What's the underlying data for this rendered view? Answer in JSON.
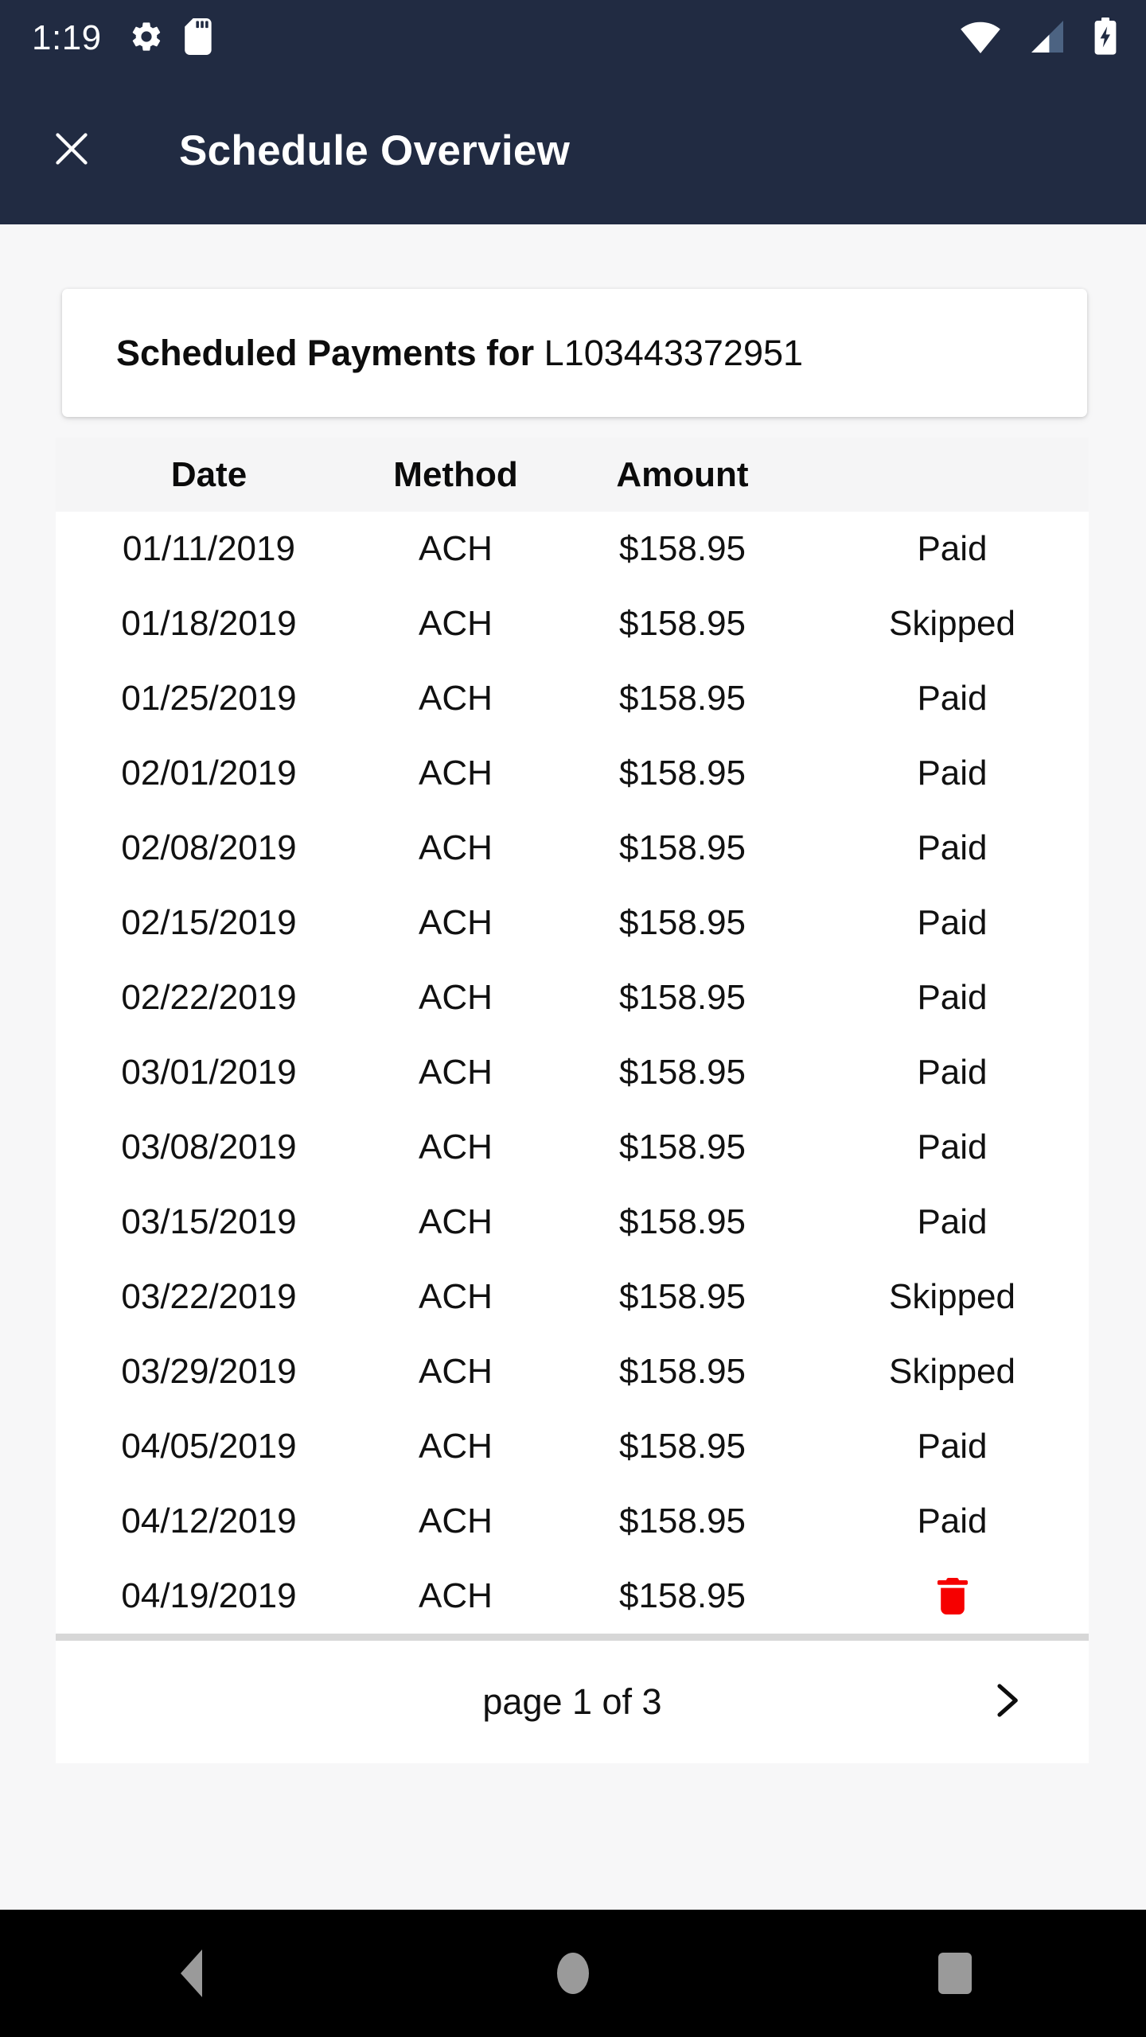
{
  "status_bar": {
    "time": "1:19",
    "left_icons": [
      "settings-gear-icon",
      "sd-card-icon"
    ],
    "right_icons": [
      "wifi-icon",
      "cellular-signal-icon",
      "battery-charging-icon"
    ],
    "background_color": "#212b42"
  },
  "app_bar": {
    "close_icon": "close-icon",
    "title": "Schedule Overview",
    "background_color": "#212b42",
    "text_color": "#ffffff"
  },
  "card": {
    "title_prefix": "Scheduled Payments for",
    "loan_id": "L103443372951"
  },
  "table": {
    "columns": [
      "Date",
      "Method",
      "Amount",
      ""
    ],
    "rows": [
      {
        "date": "01/11/2019",
        "method": "ACH",
        "amount": "$158.95",
        "status": "Paid",
        "action": ""
      },
      {
        "date": "01/18/2019",
        "method": "ACH",
        "amount": "$158.95",
        "status": "Skipped",
        "action": ""
      },
      {
        "date": "01/25/2019",
        "method": "ACH",
        "amount": "$158.95",
        "status": "Paid",
        "action": ""
      },
      {
        "date": "02/01/2019",
        "method": "ACH",
        "amount": "$158.95",
        "status": "Paid",
        "action": ""
      },
      {
        "date": "02/08/2019",
        "method": "ACH",
        "amount": "$158.95",
        "status": "Paid",
        "action": ""
      },
      {
        "date": "02/15/2019",
        "method": "ACH",
        "amount": "$158.95",
        "status": "Paid",
        "action": ""
      },
      {
        "date": "02/22/2019",
        "method": "ACH",
        "amount": "$158.95",
        "status": "Paid",
        "action": ""
      },
      {
        "date": "03/01/2019",
        "method": "ACH",
        "amount": "$158.95",
        "status": "Paid",
        "action": ""
      },
      {
        "date": "03/08/2019",
        "method": "ACH",
        "amount": "$158.95",
        "status": "Paid",
        "action": ""
      },
      {
        "date": "03/15/2019",
        "method": "ACH",
        "amount": "$158.95",
        "status": "Paid",
        "action": ""
      },
      {
        "date": "03/22/2019",
        "method": "ACH",
        "amount": "$158.95",
        "status": "Skipped",
        "action": ""
      },
      {
        "date": "03/29/2019",
        "method": "ACH",
        "amount": "$158.95",
        "status": "Skipped",
        "action": ""
      },
      {
        "date": "04/05/2019",
        "method": "ACH",
        "amount": "$158.95",
        "status": "Paid",
        "action": ""
      },
      {
        "date": "04/12/2019",
        "method": "ACH",
        "amount": "$158.95",
        "status": "Paid",
        "action": ""
      },
      {
        "date": "04/19/2019",
        "method": "ACH",
        "amount": "$158.95",
        "status": "",
        "action": "delete-icon"
      }
    ]
  },
  "pagination": {
    "label": "page 1 of 3",
    "current_page": 1,
    "total_pages": 3,
    "next_icon": "chevron-right-icon"
  },
  "nav_bar": {
    "buttons": [
      "back-icon",
      "home-icon",
      "recent-apps-icon"
    ],
    "background_color": "#000000",
    "icon_color": "#9a9a9a"
  },
  "colors": {
    "header": "#212b42",
    "page_background": "#f7f7f8",
    "card_background": "#ffffff",
    "table_header_background": "#f5f5f6",
    "delete_icon": "#f60000",
    "divider": "#d7d7d7"
  }
}
